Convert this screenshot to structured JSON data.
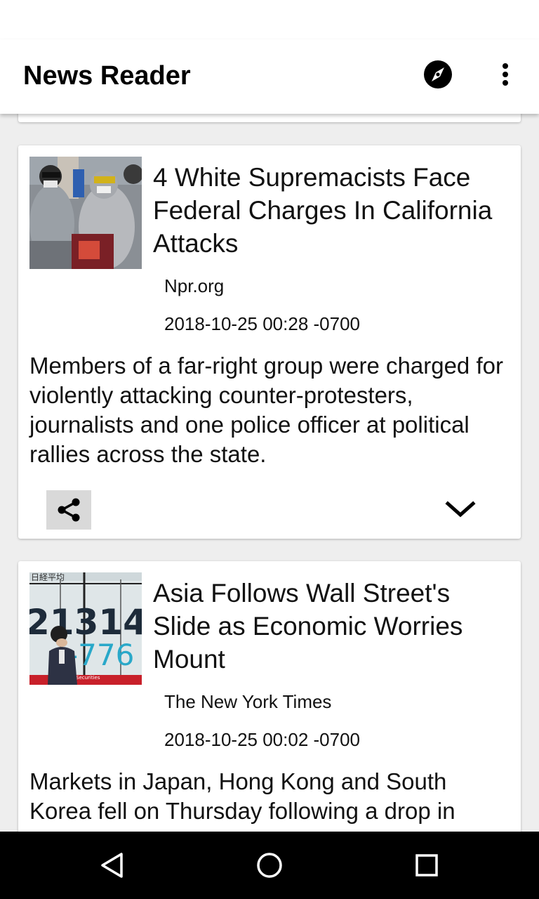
{
  "app": {
    "title": "News Reader",
    "actions": {
      "discover_icon": "compass-icon",
      "menu_icon": "more-vert-icon"
    }
  },
  "articles": [
    {
      "headline": "4 White Supremacists Face Federal Charges In California Attacks",
      "source": "Npr.org",
      "date": "2018-10-25 00:28 -0700",
      "summary": "Members of a far-right group were charged for violently attacking counter-protesters, journalists and one police officer at political rallies across the state.",
      "share_icon": "share-icon",
      "expand_icon": "chevron-down-icon"
    },
    {
      "headline": "Asia Follows Wall Street's Slide as Economic Worries Mount",
      "source": "The New York Times",
      "date": "2018-10-25 00:02 -0700",
      "summary": "Markets in Japan, Hong Kong and South Korea fell on Thursday following a drop in",
      "thumbnail_text": {
        "top": "日経平均",
        "main": "21314.",
        "change": "-776",
        "footer": "Securities"
      }
    }
  ],
  "nav": {
    "back_icon": "back-triangle-icon",
    "home_icon": "home-circle-icon",
    "recents_icon": "recents-square-icon"
  },
  "colors": {
    "app_bar": "#ffffff",
    "background": "#eeeeee",
    "card": "#ffffff",
    "nav_bar": "#000000",
    "share_bg": "#d9d9d9"
  }
}
